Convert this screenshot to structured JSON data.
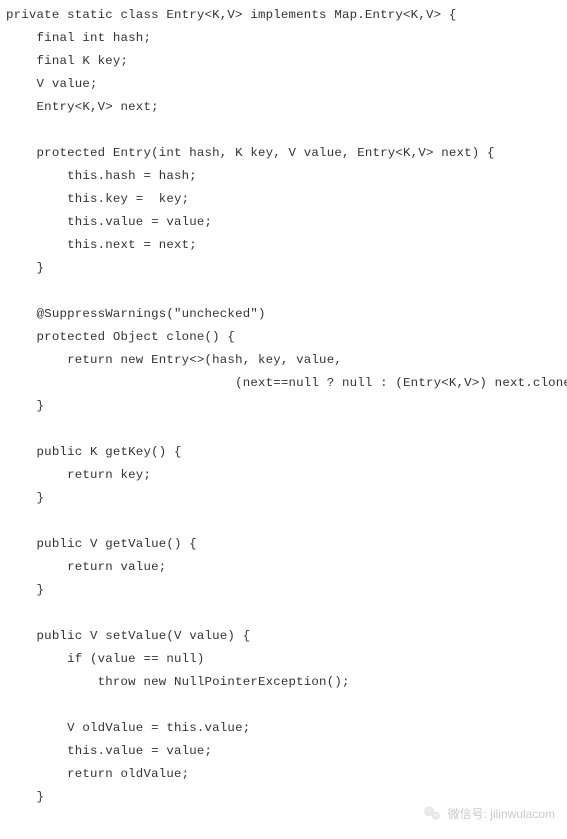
{
  "code": {
    "lines": [
      "private static class Entry<K,V> implements Map.Entry<K,V> {",
      "    final int hash;",
      "    final K key;",
      "    V value;",
      "    Entry<K,V> next;",
      "",
      "    protected Entry(int hash, K key, V value, Entry<K,V> next) {",
      "        this.hash = hash;",
      "        this.key =  key;",
      "        this.value = value;",
      "        this.next = next;",
      "    }",
      "",
      "    @SuppressWarnings(\"unchecked\")",
      "    protected Object clone() {",
      "        return new Entry<>(hash, key, value,",
      "                              (next==null ? null : (Entry<K,V>) next.clone()));",
      "    }",
      "",
      "    public K getKey() {",
      "        return key;",
      "    }",
      "",
      "    public V getValue() {",
      "        return value;",
      "    }",
      "",
      "    public V setValue(V value) {",
      "        if (value == null)",
      "            throw new NullPointerException();",
      "",
      "        V oldValue = this.value;",
      "        this.value = value;",
      "        return oldValue;",
      "    }"
    ]
  },
  "watermark": {
    "label": "微信号: jilinwulacom",
    "icon_name": "wechat-icon"
  }
}
